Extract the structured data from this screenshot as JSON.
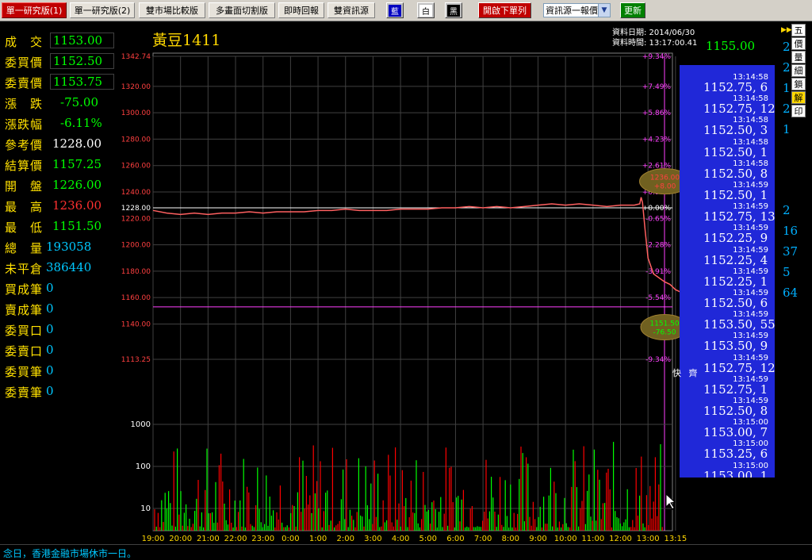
{
  "toolbar": {
    "tabs": [
      "單一研究版(1)",
      "單一研究版(2)",
      "雙市場比較版",
      "多畫面切割版",
      "即時回報",
      "雙資訊源"
    ],
    "color_buttons": [
      "藍",
      "白",
      "黑"
    ],
    "order_button": "開啟下單列",
    "source_select": "資訊源一報價",
    "update_button": "更新"
  },
  "quote": {
    "rows": [
      {
        "label": "成　交",
        "value": "1153.00",
        "color": "#00ff00",
        "boxed": true
      },
      {
        "label": "委買價",
        "value": "1152.50",
        "color": "#00ff00",
        "boxed": true
      },
      {
        "label": "委賣價",
        "value": "1153.75",
        "color": "#00ff00",
        "boxed": true
      },
      {
        "label": "漲　跌",
        "value": "-75.00",
        "color": "#00ff00",
        "boxed": false
      },
      {
        "label": "漲跌幅",
        "value": "-6.11%",
        "color": "#00ff00",
        "boxed": false
      },
      {
        "label": "參考價",
        "value": "1228.00",
        "color": "#ffffff",
        "boxed": false
      },
      {
        "label": "結算價",
        "value": "1157.25",
        "color": "#00ff00",
        "boxed": false
      },
      {
        "label": "開　盤",
        "value": "1226.00",
        "color": "#00ff00",
        "boxed": false
      },
      {
        "label": "最　高",
        "value": "1236.00",
        "color": "#ff3030",
        "boxed": false
      },
      {
        "label": "最　低",
        "value": "1151.50",
        "color": "#00ff00",
        "boxed": false
      },
      {
        "label": "總　量",
        "value": "193058",
        "color": "#00c8ff",
        "boxed": false
      },
      {
        "label": "未平倉",
        "value": "386440",
        "color": "#00c8ff",
        "boxed": false
      },
      {
        "label": "買成筆",
        "value": "0",
        "color": "#00c8ff",
        "boxed": false
      },
      {
        "label": "賣成筆",
        "value": "0",
        "color": "#00c8ff",
        "boxed": false
      },
      {
        "label": "委買口",
        "value": "0",
        "color": "#00c8ff",
        "boxed": false
      },
      {
        "label": "委賣口",
        "value": "0",
        "color": "#00c8ff",
        "boxed": false
      },
      {
        "label": "委買筆",
        "value": "0",
        "color": "#00c8ff",
        "boxed": false
      },
      {
        "label": "委賣筆",
        "value": "0",
        "color": "#00c8ff",
        "boxed": false
      }
    ]
  },
  "header": {
    "title": "黃豆1411",
    "date_label": "資料日期:  2014/06/30",
    "time_label": "資料時間:  13:17:00.41",
    "last_price": "1155.00"
  },
  "chart_data": {
    "type": "line",
    "price_axis": {
      "ticks": [
        "1342.74",
        "1320.00",
        "1300.00",
        "1280.00",
        "1260.00",
        "1240.00",
        "1228.00",
        "1220.00",
        "1200.00",
        "1180.00",
        "1160.00",
        "1140.00",
        "1113.25"
      ],
      "values": [
        1342.74,
        1320,
        1300,
        1280,
        1260,
        1240,
        1228,
        1220,
        1200,
        1180,
        1160,
        1140,
        1113.25
      ],
      "ylim": [
        1113.25,
        1342.74
      ]
    },
    "pct_axis": [
      "+9.34%",
      "+7.49%",
      "+5.86%",
      "+4.23%",
      "+2.61%",
      "+0.98%",
      "+0.00%",
      "-0.65%",
      "-2.28%",
      "-3.91%",
      "-5.54%",
      "-7.17%",
      "-9.34%"
    ],
    "reference_price": 1228,
    "lowline_price": 1153,
    "x_ticks": [
      "19:00",
      "20:00",
      "21:00",
      "22:00",
      "23:00",
      "0:00",
      "1:00",
      "2:00",
      "3:00",
      "4:00",
      "5:00",
      "6:00",
      "7:00",
      "8:00",
      "9:00",
      "10:00",
      "11:00",
      "12:00",
      "13:00",
      "13:15"
    ],
    "volume_ticks": [
      "1000",
      "100",
      "10"
    ],
    "series": [
      {
        "x": [
          0,
          0.5,
          1,
          1.5,
          2,
          2.5,
          3,
          3.5,
          4,
          4.5,
          5,
          5.5,
          6,
          6.5,
          7,
          7.5,
          8,
          8.5,
          9,
          9.5,
          10,
          10.5,
          11,
          11.5,
          12,
          12.5,
          13,
          13.5,
          14,
          14.5,
          15,
          15.5,
          16,
          16.5,
          17,
          17.5,
          17.7,
          17.75,
          17.8,
          17.9,
          18,
          18.2,
          18.4,
          18.6,
          18.8,
          18.9,
          19,
          19.1,
          19.2,
          19.3,
          19.4,
          19.5
        ],
        "y": [
          1226,
          1224,
          1223,
          1224,
          1223,
          1224,
          1224,
          1225,
          1224,
          1225,
          1225,
          1225,
          1226,
          1226,
          1227,
          1226,
          1226,
          1226,
          1227,
          1227,
          1227,
          1228,
          1228,
          1229,
          1228,
          1229,
          1228,
          1229,
          1230,
          1231,
          1230,
          1231,
          1230,
          1229,
          1230,
          1230,
          1231,
          1236,
          1232,
          1210,
          1190,
          1178,
          1175,
          1172,
          1170,
          1168,
          1166,
          1165,
          1164,
          1163,
          1162,
          1160
        ]
      }
    ],
    "high_annotation": [
      "1236.00",
      "+8.00"
    ],
    "low_annotation": [
      "1151.50",
      "-76.50"
    ]
  },
  "ticks": [
    {
      "time": "13:14:58",
      "pv": "1152.75, 6"
    },
    {
      "time": "13:14:58",
      "pv": "1152.75, 12"
    },
    {
      "time": "13:14:58",
      "pv": "1152.50, 3"
    },
    {
      "time": "13:14:58",
      "pv": "1152.50, 1"
    },
    {
      "time": "13:14:58",
      "pv": "1152.50, 8"
    },
    {
      "time": "13:14:59",
      "pv": "1152.50, 1"
    },
    {
      "time": "13:14:59",
      "pv": "1152.75, 13"
    },
    {
      "time": "13:14:59",
      "pv": "1152.25, 9"
    },
    {
      "time": "13:14:59",
      "pv": "1152.25, 4"
    },
    {
      "time": "13:14:59",
      "pv": "1152.25, 1"
    },
    {
      "time": "13:14:59",
      "pv": "1152.50, 6"
    },
    {
      "time": "13:14:59",
      "pv": "1153.50, 55"
    },
    {
      "time": "13:14:59",
      "pv": "1153.50, 9"
    },
    {
      "time": "13:14:59",
      "pv": "1152.75, 12"
    },
    {
      "time": "13:14:59",
      "pv": "1152.75, 1"
    },
    {
      "time": "13:14:59",
      "pv": "1152.50, 8"
    },
    {
      "time": "13:15:00",
      "pv": "1153.00, 7"
    },
    {
      "time": "13:15:00",
      "pv": "1153.25, 6"
    },
    {
      "time": "13:15:00",
      "pv": "1153.00, 1"
    }
  ],
  "side_volumes": [
    "2",
    "2",
    "1",
    "2",
    "1",
    "2",
    "16",
    "37",
    "5",
    "64"
  ],
  "vertical_tabs": [
    "五",
    "價",
    "量",
    "細",
    "鎖",
    "解",
    "印"
  ],
  "mini_buttons": [
    "快",
    "齊"
  ],
  "status": "念日，香港金融市場休市一日。",
  "colors": {
    "price_line": "#ff6060",
    "ref_line": "#ffffff",
    "low_line": "#ff40ff",
    "grid": "#404040",
    "vol_up": "#ff0000",
    "vol_down": "#00ff00",
    "tick_panel": "#2028d8"
  }
}
